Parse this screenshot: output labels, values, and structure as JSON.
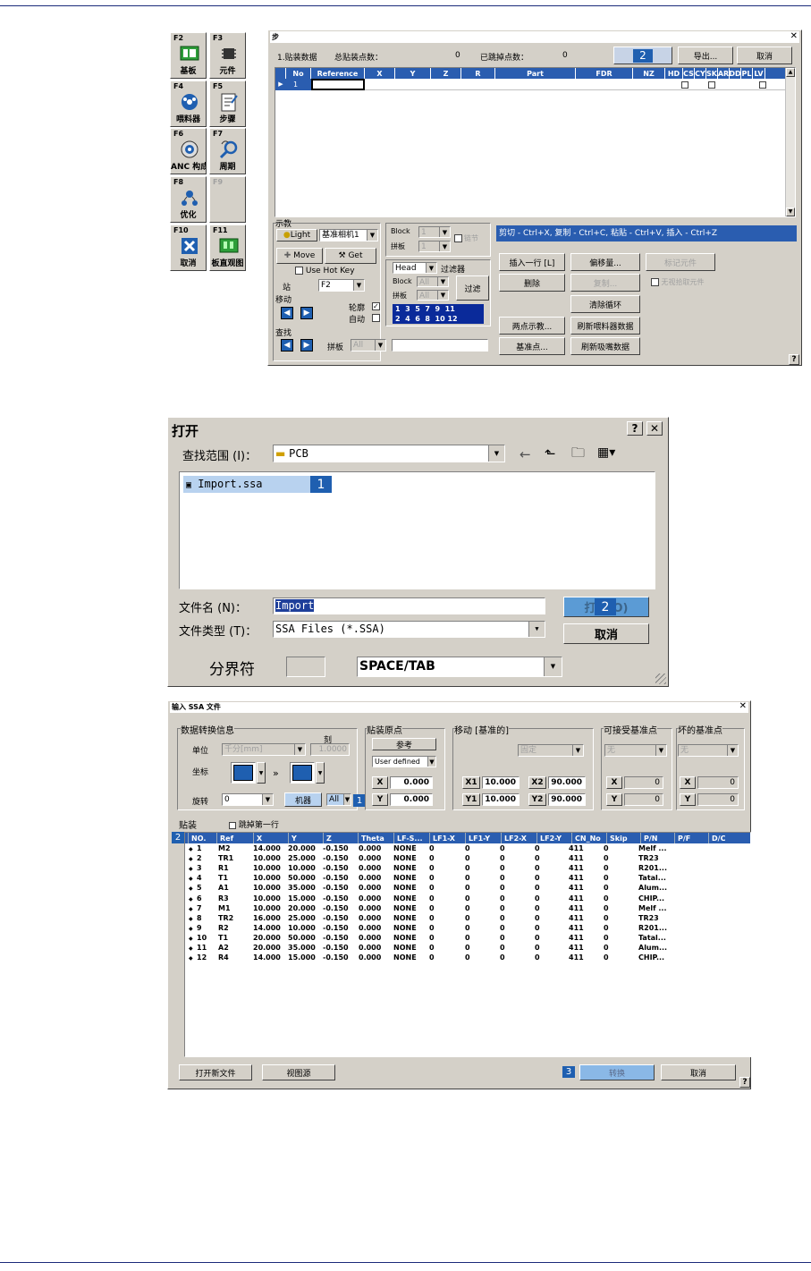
{
  "colors": {
    "rule": "#1a2a7a",
    "accent": "#1f5fb0",
    "header": "#2a5db0",
    "panel": "#d4d0c8"
  },
  "fkeys": [
    {
      "key": "F2",
      "label": "基板",
      "icon": "board-icon"
    },
    {
      "key": "F3",
      "label": "元件",
      "icon": "chip-icon"
    },
    {
      "key": "F4",
      "label": "喂料器",
      "icon": "feeder-icon"
    },
    {
      "key": "F5",
      "label": "步骤",
      "icon": "step-icon"
    },
    {
      "key": "F6",
      "label": "ANC 构成",
      "icon": "nozzle-icon"
    },
    {
      "key": "F7",
      "label": "周期",
      "icon": "magnifier-icon"
    },
    {
      "key": "F8",
      "label": "优化",
      "icon": "optimize-icon"
    },
    {
      "key": "F9",
      "label": "",
      "icon": ""
    },
    {
      "key": "F10",
      "label": "取消",
      "icon": "cancel-icon"
    },
    {
      "key": "F11",
      "label": "板直观图",
      "icon": "board-view-icon"
    }
  ],
  "step_window": {
    "title": "步",
    "count_label": "1.贴装数据",
    "total_label": "总贴装点数：",
    "total_value": "0",
    "skipped_label": "已跳掉点数：",
    "skipped_value": "0",
    "badge": "2",
    "export_button": "导出...",
    "cancel_button": "取消",
    "columns": [
      "No",
      "Reference",
      "X",
      "Y",
      "Z",
      "R",
      "Part",
      "FDR",
      "NZ",
      "HD",
      "CS",
      "CY",
      "SK",
      "AR",
      "DD",
      "PL",
      "LV"
    ],
    "row_no": "1",
    "teach_group": "示教",
    "light_button": "Light",
    "camera_select": "基准相机1",
    "move_button": "Move",
    "get_button": "Get",
    "hotkey_label": "Use Hot Key",
    "station_label": "站",
    "station_value": "F2",
    "move_group": "移动",
    "outline_label": "轮廓",
    "auto_label": "自动",
    "find_group": "查找",
    "panel_label": "拼板",
    "panel_value": "All",
    "block_label": "Block",
    "block_value": "1",
    "panel_label2": "拼板",
    "panel_value2": "1",
    "link_label": "链节",
    "head_select": "Head",
    "filter_label": "过滤器",
    "filter_block_label": "Block",
    "filter_block_value": "All",
    "filter_panel_label": "拼板",
    "filter_panel_value": "All",
    "filter_button": "过滤",
    "head_numbers_top": "1  3  5  7  9  11",
    "head_numbers_bottom": "2  4  6  8  10 12",
    "hint": "剪切 - Ctrl+X, 复制 - Ctrl+C, 粘贴 - Ctrl+V, 插入 - Ctrl+Z",
    "insert_row": "插入一行 [L]",
    "offset": "偏移量...",
    "mark_part": "标记元件",
    "delete": "删除",
    "copy": "复制...",
    "skip_pick": "无视拾取元件",
    "clear_loop": "清除循环",
    "two_point": "两点示教...",
    "refresh_feeder": "刷新喂料器数据",
    "fiducial": "基准点...",
    "refresh_glue": "刷新吸嘴数据",
    "help": "?"
  },
  "open_dialog": {
    "title": "打开",
    "look_in_label": "查找范围 (I)：",
    "look_in_value": "PCB",
    "file_item": "Import.ssa",
    "badge1": "1",
    "filename_label": "文件名 (N)：",
    "filename_value": "Import",
    "filetype_label": "文件类型 (T)：",
    "filetype_value": "SSA Files (*.SSA)",
    "open_button": "打开(O)",
    "badge2": "2",
    "cancel_button": "取消",
    "delimiter_label": "分界符",
    "delimiter_value": "SPACE/TAB"
  },
  "ssa_dialog": {
    "title": "输入 SSA 文件",
    "conv_group": "数据转换信息",
    "unit_label": "单位",
    "unit_value": "千分[mm]",
    "scale_label": "刻",
    "scale_value": "1.0000",
    "coord_label": "坐标",
    "rotate_label": "旋转",
    "rotate_value": "0",
    "machine_button": "机器",
    "machine_value": "All",
    "badge1": "1",
    "origin_group": "贴装原点",
    "ref_button": "参考",
    "origin_select": "User defined",
    "origin_x": "0.000",
    "origin_y": "0.000",
    "move_group": "移动 [基准的]",
    "move_select": "固定",
    "x1": "10.000",
    "x2": "90.000",
    "y1": "10.000",
    "y2": "90.000",
    "accept_group": "可接受基准点",
    "accept_select": "无",
    "accept_x": "0",
    "accept_y": "0",
    "bad_group": "坏的基准点",
    "bad_select": "无",
    "bad_x": "0",
    "bad_y": "0",
    "mount_label": "贴装",
    "skip_first": "跳掉第一行",
    "badge2": "2",
    "columns": [
      "NO.",
      "Ref",
      "X",
      "Y",
      "Z",
      "Theta",
      "LF-S...",
      "LF1-X",
      "LF1-Y",
      "LF2-X",
      "LF2-Y",
      "CN_No",
      "Skip",
      "P/N",
      "P/F",
      "D/C"
    ],
    "rows": [
      [
        "1",
        "M2",
        "14.000",
        "20.000",
        "-0.150",
        "0.000",
        "NONE",
        "0",
        "0",
        "0",
        "0",
        "411",
        "0",
        "Melf ..."
      ],
      [
        "2",
        "TR1",
        "10.000",
        "25.000",
        "-0.150",
        "0.000",
        "NONE",
        "0",
        "0",
        "0",
        "0",
        "411",
        "0",
        "TR23"
      ],
      [
        "3",
        "R1",
        "10.000",
        "10.000",
        "-0.150",
        "0.000",
        "NONE",
        "0",
        "0",
        "0",
        "0",
        "411",
        "0",
        "R201..."
      ],
      [
        "4",
        "T1",
        "10.000",
        "50.000",
        "-0.150",
        "0.000",
        "NONE",
        "0",
        "0",
        "0",
        "0",
        "411",
        "0",
        "Tatal..."
      ],
      [
        "5",
        "A1",
        "10.000",
        "35.000",
        "-0.150",
        "0.000",
        "NONE",
        "0",
        "0",
        "0",
        "0",
        "411",
        "0",
        "Alum..."
      ],
      [
        "6",
        "R3",
        "10.000",
        "15.000",
        "-0.150",
        "0.000",
        "NONE",
        "0",
        "0",
        "0",
        "0",
        "411",
        "0",
        "CHIP..."
      ],
      [
        "7",
        "M1",
        "10.000",
        "20.000",
        "-0.150",
        "0.000",
        "NONE",
        "0",
        "0",
        "0",
        "0",
        "411",
        "0",
        "Melf ..."
      ],
      [
        "8",
        "TR2",
        "16.000",
        "25.000",
        "-0.150",
        "0.000",
        "NONE",
        "0",
        "0",
        "0",
        "0",
        "411",
        "0",
        "TR23"
      ],
      [
        "9",
        "R2",
        "14.000",
        "10.000",
        "-0.150",
        "0.000",
        "NONE",
        "0",
        "0",
        "0",
        "0",
        "411",
        "0",
        "R201..."
      ],
      [
        "10",
        "T1",
        "20.000",
        "50.000",
        "-0.150",
        "0.000",
        "NONE",
        "0",
        "0",
        "0",
        "0",
        "411",
        "0",
        "Tatal..."
      ],
      [
        "11",
        "A2",
        "20.000",
        "35.000",
        "-0.150",
        "0.000",
        "NONE",
        "0",
        "0",
        "0",
        "0",
        "411",
        "0",
        "Alum..."
      ],
      [
        "12",
        "R4",
        "14.000",
        "15.000",
        "-0.150",
        "0.000",
        "NONE",
        "0",
        "0",
        "0",
        "0",
        "411",
        "0",
        "CHIP..."
      ]
    ],
    "open_new": "打开新文件",
    "view_source": "视图源",
    "badge3": "3",
    "convert": "转换",
    "cancel": "取消",
    "help": "?"
  }
}
